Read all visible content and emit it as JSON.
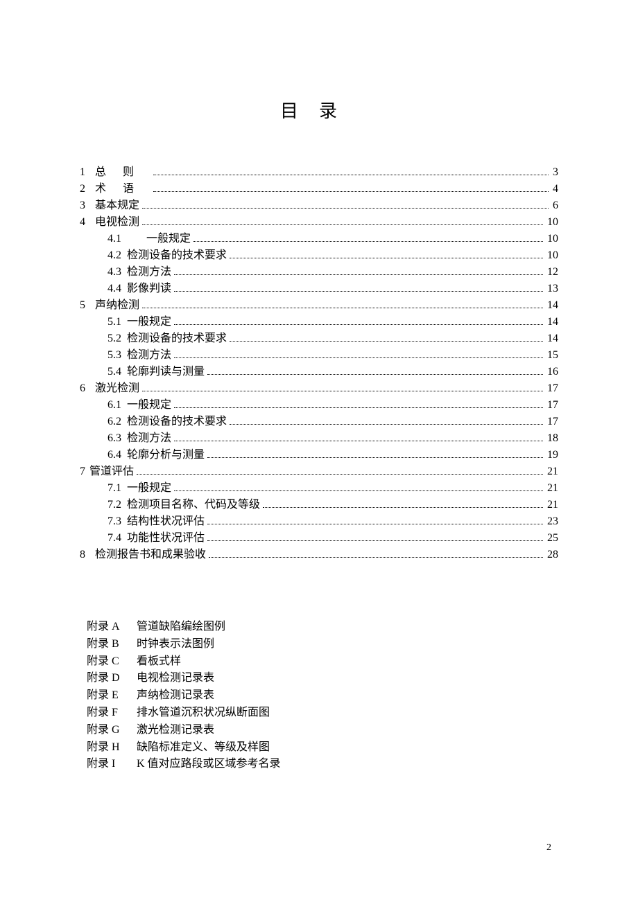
{
  "title": "目录",
  "toc": [
    {
      "level": 1,
      "num": "1",
      "label": "总则",
      "page": "3",
      "spread": true
    },
    {
      "level": 1,
      "num": "2",
      "label": "术语",
      "page": "4",
      "spread": true
    },
    {
      "level": 1,
      "num": "3",
      "label": "基本规定",
      "page": "6",
      "wide_num": false
    },
    {
      "level": 1,
      "num": "4",
      "label": "电视检测",
      "page": "10"
    },
    {
      "level": 2,
      "num": "4.1",
      "label": "一般规定",
      "page": "10",
      "wide_num": true
    },
    {
      "level": 2,
      "num": "4.2",
      "label": "检测设备的技术要求",
      "page": "10"
    },
    {
      "level": 2,
      "num": "4.3",
      "label": "检测方法",
      "page": "12"
    },
    {
      "level": 2,
      "num": "4.4",
      "label": "影像判读",
      "page": "13"
    },
    {
      "level": 1,
      "num": "5",
      "label": "声纳检测",
      "page": "14"
    },
    {
      "level": 2,
      "num": "5.1",
      "label": "一般规定",
      "page": "14"
    },
    {
      "level": 2,
      "num": "5.2",
      "label": "检测设备的技术要求",
      "page": "14"
    },
    {
      "level": 2,
      "num": "5.3",
      "label": "检测方法",
      "page": "15"
    },
    {
      "level": 2,
      "num": "5.4",
      "label": "轮廓判读与测量",
      "page": "16"
    },
    {
      "level": 1,
      "num": "6",
      "label": "激光检测",
      "page": "17"
    },
    {
      "level": 2,
      "num": "6.1",
      "label": "一般规定",
      "page": "17"
    },
    {
      "level": 2,
      "num": "6.2",
      "label": "检测设备的技术要求",
      "page": "17"
    },
    {
      "level": 2,
      "num": "6.3",
      "label": "检测方法",
      "page": "18"
    },
    {
      "level": 2,
      "num": "6.4",
      "label": "轮廓分析与测量",
      "page": "19"
    },
    {
      "level": 1,
      "num": "7",
      "label": "管道评估",
      "page": "21",
      "tight": true
    },
    {
      "level": 2,
      "num": "7.1",
      "label": "一般规定",
      "page": "21"
    },
    {
      "level": 2,
      "num": "7.2",
      "label": "检测项目名称、代码及等级",
      "page": "21"
    },
    {
      "level": 2,
      "num": "7.3",
      "label": "结构性状况评估",
      "page": "23"
    },
    {
      "level": 2,
      "num": "7.4",
      "label": "功能性状况评估",
      "page": "25"
    },
    {
      "level": 1,
      "num": "8",
      "label": "检测报告书和成果验收",
      "page": "28"
    }
  ],
  "appendix": [
    {
      "label": "附录 A",
      "title": "管道缺陷编绘图例"
    },
    {
      "label": "附录 B",
      "title": "时钟表示法图例"
    },
    {
      "label": "附录 C",
      "title": "看板式样"
    },
    {
      "label": "附录 D",
      "title": "电视检测记录表"
    },
    {
      "label": "附录 E",
      "title": "声纳检测记录表"
    },
    {
      "label": "附录 F",
      "title": "排水管道沉积状况纵断面图"
    },
    {
      "label": "附录 G",
      "title": "激光检测记录表"
    },
    {
      "label": "附录 H",
      "title": "缺陷标准定义、等级及样图"
    },
    {
      "label": "附录 I",
      "title": "K 值对应路段或区域参考名录"
    }
  ],
  "page_number": "2"
}
